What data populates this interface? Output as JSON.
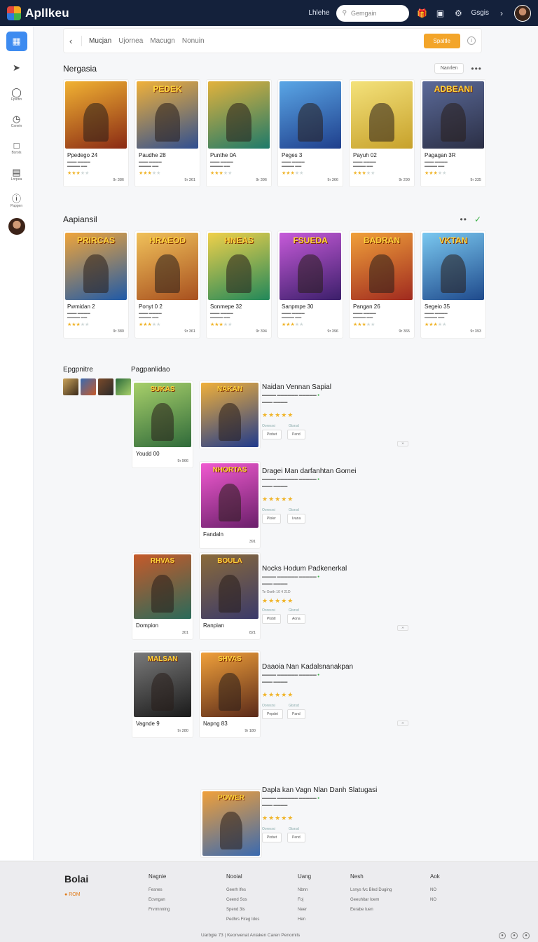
{
  "header": {
    "brand": "Apllkeu",
    "link": "Lhlehe",
    "search_placeholder": "Gemgain",
    "lang": "Gsgis"
  },
  "sidebar": [
    {
      "icon": "grid-icon",
      "label": ""
    },
    {
      "icon": "pin-icon",
      "label": ""
    },
    {
      "icon": "coin-icon",
      "label": "Fpsrtin"
    },
    {
      "icon": "clock-icon",
      "label": "Csnein"
    },
    {
      "icon": "chat-icon",
      "label": "Bsrols"
    },
    {
      "icon": "bag-icon",
      "label": "Lnrpea"
    },
    {
      "icon": "info-icon",
      "label": "Papgen"
    }
  ],
  "toolbar": {
    "tabs": [
      "Mucjan",
      "Ujornea",
      "Macugn",
      "Nonuin"
    ],
    "action": "Spaltle"
  },
  "section1": {
    "title": "Nergasia",
    "pill": "Nanrlen",
    "cards": [
      {
        "name": "Ppedego 24",
        "price": "9r 386",
        "art": "",
        "c1": "#8a2a14",
        "c2": "#f1b233"
      },
      {
        "name": "Paudhe 28",
        "price": "9r 361",
        "art": "PEDEK",
        "c1": "#2f4f91",
        "c2": "#f0b13a"
      },
      {
        "name": "Punthe 0A",
        "price": "9r 396",
        "art": "",
        "c1": "#1d7a6a",
        "c2": "#e2b23c"
      },
      {
        "name": "Peges 3",
        "price": "9r 366",
        "art": "",
        "c1": "#1f3f8c",
        "c2": "#5aa6e6"
      },
      {
        "name": "Payuh 02",
        "price": "9r 290",
        "art": "",
        "c1": "#c7a12b",
        "c2": "#f4e27b"
      },
      {
        "name": "Pagagan 3R",
        "price": "9r 335",
        "art": "ADBEANI",
        "c1": "#2b2f45",
        "c2": "#5b6a99"
      }
    ]
  },
  "section2": {
    "title": "Aapiansil",
    "cards": [
      {
        "name": "Pwmidan 2",
        "price": "9r 380",
        "art": "PRIRCAS",
        "c1": "#1f5aa8",
        "c2": "#f0a53a"
      },
      {
        "name": "Ponyt 0 2",
        "price": "9r 361",
        "art": "HRAEOD",
        "c1": "#a8501f",
        "c2": "#f0c15a"
      },
      {
        "name": "Sonmepe 32",
        "price": "9r 394",
        "art": "HNEAS",
        "c1": "#21885a",
        "c2": "#f0d04a"
      },
      {
        "name": "Sanpmpe 30",
        "price": "9r 396",
        "art": "FSUEDA",
        "c1": "#3b1f6a",
        "c2": "#c65ad9"
      },
      {
        "name": "Pangan 26",
        "price": "9r 365",
        "art": "BADRAN",
        "c1": "#a02a1f",
        "c2": "#f0a03a"
      },
      {
        "name": "Segeio 35",
        "price": "9r 393",
        "art": "VKTAN",
        "c1": "#1f4a8c",
        "c2": "#7ac8f0"
      }
    ]
  },
  "lower": {
    "left_title": "Epgpnitre",
    "list_title": "Pagpanlidao",
    "entries": [
      {
        "title": "Naidan Vennan Sapial",
        "meta": [
          "Ooresrsi",
          "Gtsrsd"
        ],
        "buttons": [
          "Piobet",
          "Pend"
        ]
      },
      {
        "title": "Dragei Man darfanhtan Gomei",
        "meta": [
          "Ooresrsi",
          "Gtsrsd"
        ],
        "buttons": [
          "Ploler",
          "Ivana"
        ]
      },
      {
        "title": "Nocks Hodum Padkenerkal",
        "meta": [
          "Ooresrsi",
          "Gtsrsd"
        ],
        "buttons": [
          "Plobtl",
          "Aona"
        ],
        "extra": "Te Osrth 10 4 21D"
      },
      {
        "title": "Daaoia Nan Kadalsnanakpan",
        "meta": [
          "Ooresrsi",
          "Gtsrsd"
        ],
        "buttons": [
          "Pepdet",
          "Pand"
        ]
      },
      {
        "title": "Dapla kan Vagn Nlan Danh Slatugasi",
        "meta": [
          "Ooresrsi",
          "Gtsrsd"
        ],
        "buttons": [
          "Piobet",
          "Pend"
        ]
      }
    ],
    "small_cards": [
      {
        "name": "Youdd 00",
        "price": "9r 966",
        "art": "SUKAS",
        "c1": "#2f6a3a",
        "c2": "#a8d06a"
      },
      {
        "name": "",
        "price": "",
        "art": "NAKAN",
        "c1": "#1f3a8c",
        "c2": "#f0b03a"
      },
      {
        "name": "Fandaln",
        "price": "391",
        "art": "NHORTAS",
        "c1": "#6a1f6a",
        "c2": "#f05ad0"
      },
      {
        "name": "Dompion",
        "price": "301",
        "art": "RHVAS",
        "c1": "#2a6a5a",
        "c2": "#c65a2a"
      },
      {
        "name": "Ranpian",
        "price": "821",
        "art": "BOULA",
        "c1": "#3a3a6a",
        "c2": "#8a6a3a"
      },
      {
        "name": "Vagnde 9",
        "price": "9r 280",
        "art": "MALSAN",
        "c1": "#1a1a1a",
        "c2": "#7a7a7a"
      },
      {
        "name": "Napng 83",
        "price": "9r 180",
        "art": "SHVAS",
        "c1": "#5a2a1a",
        "c2": "#f0a03a"
      },
      {
        "name": "",
        "price": "",
        "art": "POWER",
        "c1": "#3a6ab0",
        "c2": "#f0a03a"
      }
    ]
  },
  "footer": {
    "brand": "Bolai",
    "tag": "ROM",
    "cols": [
      {
        "title": "Nagnie",
        "items": [
          "Fesnes",
          "Eovngan",
          "Frvrmnning"
        ]
      },
      {
        "title": "Nooial",
        "items": [
          "Geerh Ifes",
          "Ceend Sos",
          "Spend 3is",
          "Pedhrs Fireg Idos"
        ]
      },
      {
        "title": "Uang",
        "items": [
          "Nbnn",
          "Foj",
          "Neer",
          "Hen"
        ]
      },
      {
        "title": "Nesh",
        "items": [
          "Lsnys fvc Bled Duging",
          "Geeuhitar Ioem",
          "Eerabe Iuen"
        ]
      },
      {
        "title": "Aok",
        "items": [
          "NO",
          "NO"
        ]
      }
    ],
    "copyright": "Uarbgle 73 | Keonvenat Anlaken Caren Penomils"
  }
}
